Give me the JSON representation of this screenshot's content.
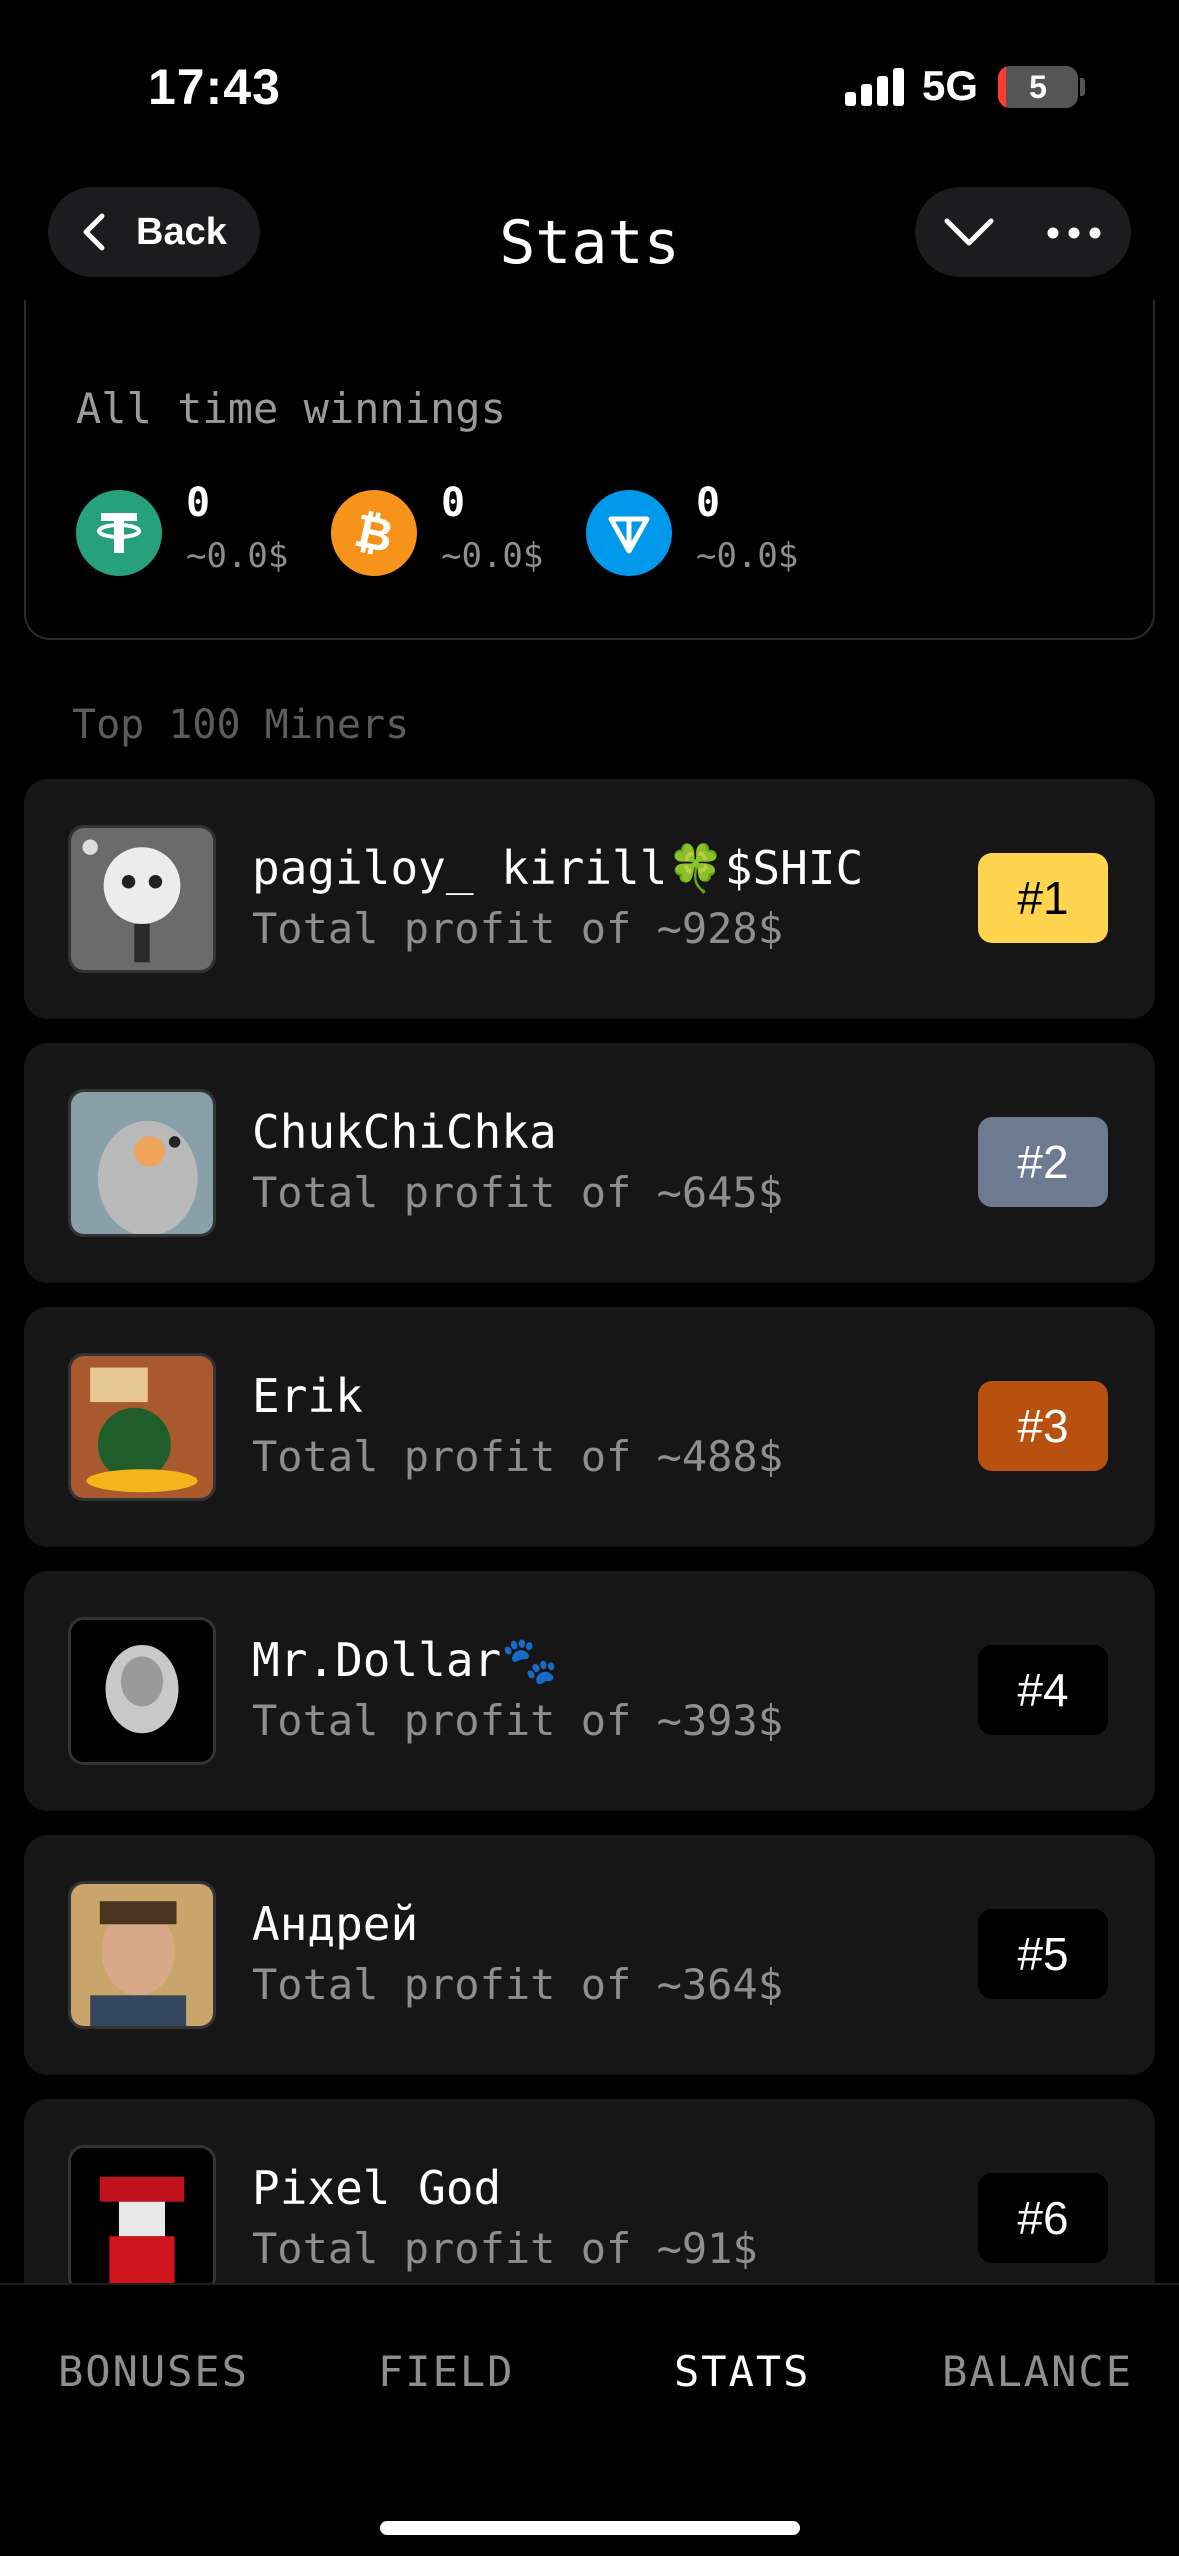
{
  "status_bar": {
    "time": "17:43",
    "network": "5G",
    "battery": "5"
  },
  "header": {
    "back_label": "Back",
    "title": "Stats"
  },
  "winnings": {
    "title": "All time winnings",
    "coins": [
      {
        "icon": "tether-icon",
        "amount": "0",
        "usd": "~0.0$",
        "color": "#26a17b"
      },
      {
        "icon": "bitcoin-icon",
        "amount": "0",
        "usd": "~0.0$",
        "color": "#f7931a"
      },
      {
        "icon": "ton-icon",
        "amount": "0",
        "usd": "~0.0$",
        "color": "#0098ea"
      }
    ]
  },
  "leaderboard": {
    "title": "Top 100 Miners",
    "miners": [
      {
        "name": "pagiloy_ kirill🍀$SHIC",
        "profit": "Total profit of ~928$",
        "rank": "#1",
        "badge_bg": "#ffd54f",
        "badge_fg": "#000000"
      },
      {
        "name": "ChukChiChka",
        "profit": "Total profit of ~645$",
        "rank": "#2",
        "badge_bg": "#6e7a8f",
        "badge_fg": "#ffffff"
      },
      {
        "name": "Erik",
        "profit": "Total profit of ~488$",
        "rank": "#3",
        "badge_bg": "#b8510f",
        "badge_fg": "#ffffff"
      },
      {
        "name": "Mr.Dollar🐾",
        "profit": "Total profit of ~393$",
        "rank": "#4",
        "badge_bg": "#000000",
        "badge_fg": "#ffffff"
      },
      {
        "name": "Андрей",
        "profit": "Total profit of ~364$",
        "rank": "#5",
        "badge_bg": "#000000",
        "badge_fg": "#ffffff"
      },
      {
        "name": "Pixel God",
        "profit": "Total profit of ~91$",
        "rank": "#6",
        "badge_bg": "#000000",
        "badge_fg": "#ffffff"
      }
    ]
  },
  "nav": {
    "tabs": [
      {
        "label": "BONUSES",
        "active": false
      },
      {
        "label": "FIELD",
        "active": false
      },
      {
        "label": "STATS",
        "active": true
      },
      {
        "label": "BALANCE",
        "active": false
      }
    ]
  }
}
